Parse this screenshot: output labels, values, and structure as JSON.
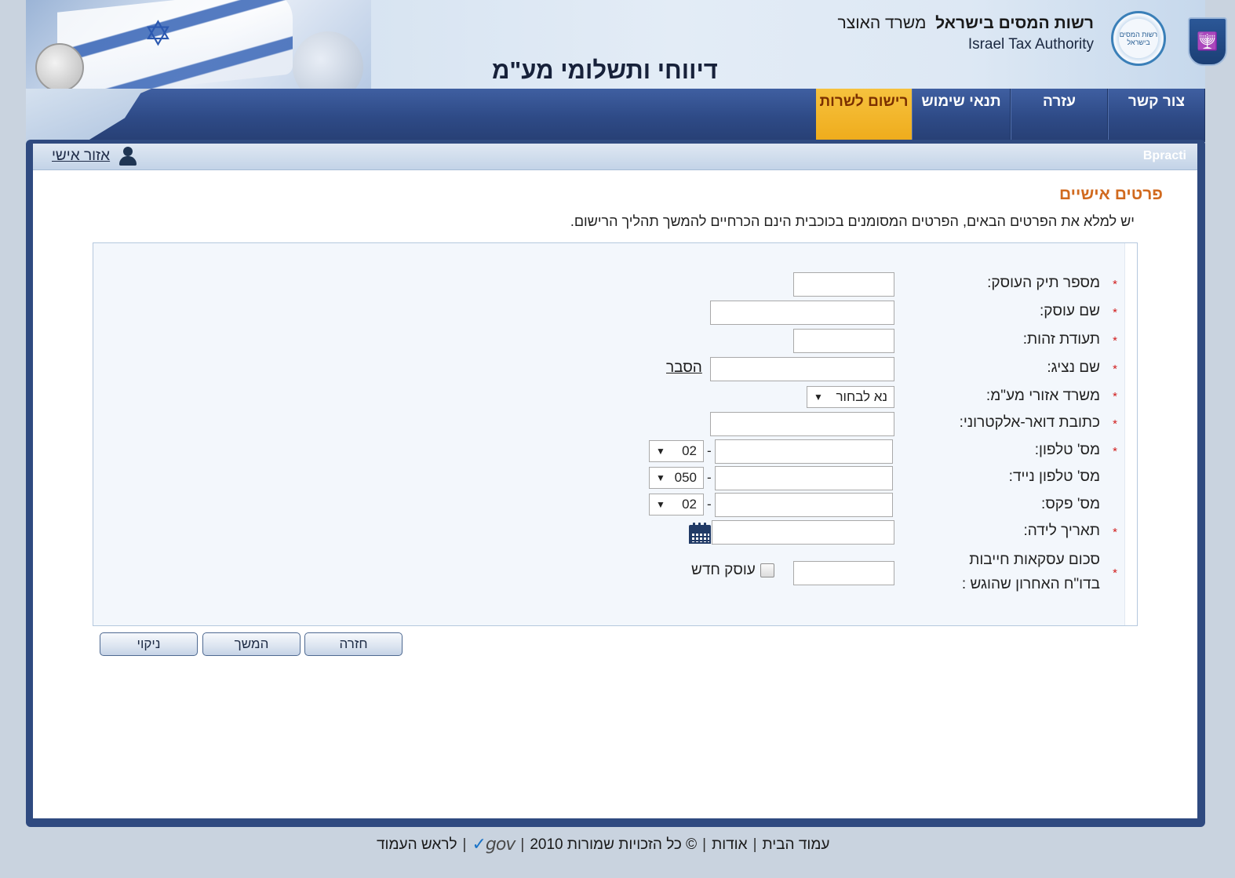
{
  "header": {
    "page_title": "דיווחי ותשלומי מע\"מ",
    "org_name_he_bold": "רשות המסים בישראל",
    "org_ministry_he": "משרד האוצר",
    "org_name_en": "Israel Tax Authority",
    "tax_logo_text": "רשות המסים בישראל"
  },
  "nav": {
    "tabs": [
      {
        "label": "רישום לשרות",
        "active": true
      },
      {
        "label": "תנאי שימוש",
        "active": false
      },
      {
        "label": "עזרה",
        "active": false
      },
      {
        "label": "צור קשר",
        "active": false
      }
    ]
  },
  "subheader": {
    "user_name": "Bpracti",
    "personal_area": "אזור אישי"
  },
  "section": {
    "title": "פרטים אישיים",
    "intro": "יש למלא את הפרטים הבאים, הפרטים המסומנים בכוכבית הינם הכרחיים להמשך תהליך הרישום."
  },
  "form": {
    "required_mark": "*",
    "fields": {
      "file_number": {
        "label": "מספר תיק העוסק:",
        "value": ""
      },
      "business_name": {
        "label": "שם עוסק:",
        "value": ""
      },
      "id_number": {
        "label": "תעודת זהות:",
        "value": ""
      },
      "representative": {
        "label": "שם נציג:",
        "value": "",
        "link": "הסבר"
      },
      "vat_office": {
        "label": "משרד אזורי מע\"מ:",
        "selected": "נא לבחור"
      },
      "email": {
        "label": "כתובת דואר-אלקטרוני:",
        "value": ""
      },
      "phone": {
        "label": "מס' טלפון:",
        "value": "",
        "prefix": "02"
      },
      "mobile": {
        "label": "מס' טלפון נייד:",
        "value": "",
        "prefix": "050"
      },
      "fax": {
        "label": "מס' פקס:",
        "value": "",
        "prefix": "02"
      },
      "birth_date": {
        "label": "תאריך לידה:",
        "value": ""
      },
      "taxable_sum": {
        "label_line1": "סכום עסקאות חייבות",
        "label_line2": "בדו\"ח האחרון שהוגש :",
        "value": "",
        "new_business_label": "עוסק חדש"
      }
    },
    "dash": "-",
    "buttons": {
      "back": "חזרה",
      "continue": "המשך",
      "clear": "ניקוי"
    }
  },
  "footer": {
    "home": "עמוד הבית",
    "about": "אודות",
    "copyright": "© כל הזכויות שמורות 2010",
    "gov_logo": "gov",
    "top": "לראש העמוד",
    "separator": "|"
  },
  "colors": {
    "nav_bg": "#2e4a86",
    "active_tab": "#f6c23e",
    "section_title": "#d16a1f",
    "required": "#d11c1c"
  }
}
